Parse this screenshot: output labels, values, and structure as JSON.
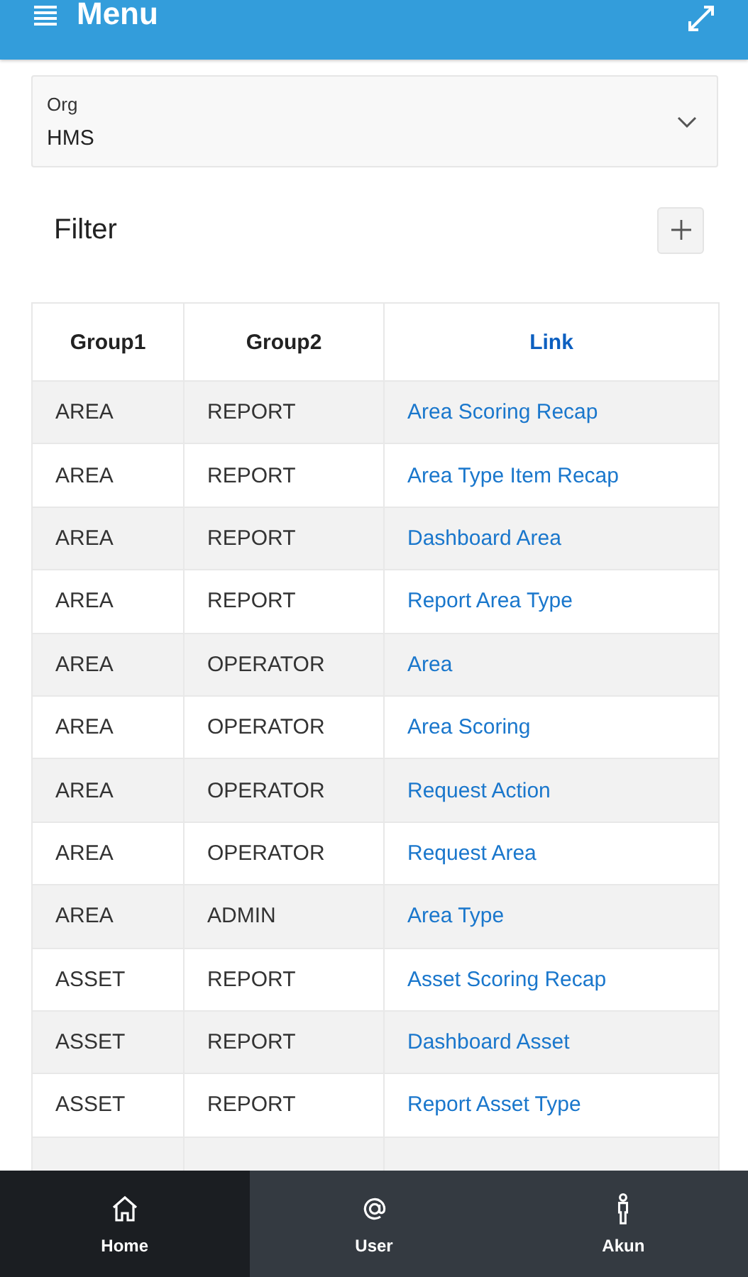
{
  "header": {
    "title": "Menu"
  },
  "org_select": {
    "label": "Org",
    "value": "HMS"
  },
  "filter": {
    "title": "Filter"
  },
  "table": {
    "columns": [
      "Group1",
      "Group2",
      "Link"
    ],
    "rows": [
      {
        "group1": "AREA",
        "group2": "REPORT",
        "link": "Area Scoring Recap"
      },
      {
        "group1": "AREA",
        "group2": "REPORT",
        "link": "Area Type Item Recap"
      },
      {
        "group1": "AREA",
        "group2": "REPORT",
        "link": "Dashboard Area"
      },
      {
        "group1": "AREA",
        "group2": "REPORT",
        "link": "Report Area Type"
      },
      {
        "group1": "AREA",
        "group2": "OPERATOR",
        "link": "Area"
      },
      {
        "group1": "AREA",
        "group2": "OPERATOR",
        "link": "Area Scoring"
      },
      {
        "group1": "AREA",
        "group2": "OPERATOR",
        "link": "Request Action"
      },
      {
        "group1": "AREA",
        "group2": "OPERATOR",
        "link": "Request Area"
      },
      {
        "group1": "AREA",
        "group2": "ADMIN",
        "link": "Area Type"
      },
      {
        "group1": "ASSET",
        "group2": "REPORT",
        "link": "Asset Scoring Recap"
      },
      {
        "group1": "ASSET",
        "group2": "REPORT",
        "link": "Dashboard Asset"
      },
      {
        "group1": "ASSET",
        "group2": "REPORT",
        "link": "Report Asset Type"
      }
    ]
  },
  "bottom_nav": [
    {
      "kind": "home",
      "label": "Home",
      "selected": true
    },
    {
      "kind": "at",
      "label": "User",
      "selected": false
    },
    {
      "kind": "person",
      "label": "Akun",
      "selected": false
    }
  ]
}
